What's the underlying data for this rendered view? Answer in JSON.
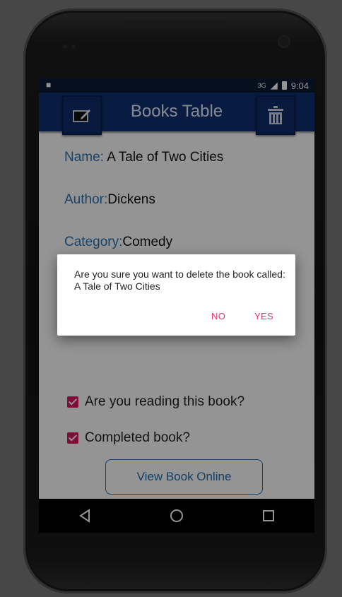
{
  "status_bar": {
    "network": "3G",
    "time": "9:04"
  },
  "app_bar": {
    "title": "Books Table"
  },
  "book": {
    "name_label": "Name:",
    "name_value": " A Tale of Two Cities",
    "author_label": "Author:",
    "author_value": "Dickens",
    "category_label": "Category:",
    "category_value": "Comedy"
  },
  "checkboxes": [
    {
      "label": "Are you reading this book?",
      "checked": true
    },
    {
      "label": "Completed book?",
      "checked": true
    }
  ],
  "view_button": {
    "label": "View Book Online"
  },
  "dialog": {
    "message": "Are you sure you want to delete the book called: A Tale of Two Cities",
    "no_label": "NO",
    "yes_label": "YES"
  },
  "colors": {
    "app_bar": "#0f2f70",
    "label_blue": "#2874b3",
    "accent_pink": "#e6336f",
    "checkbox": "#d81b60"
  }
}
